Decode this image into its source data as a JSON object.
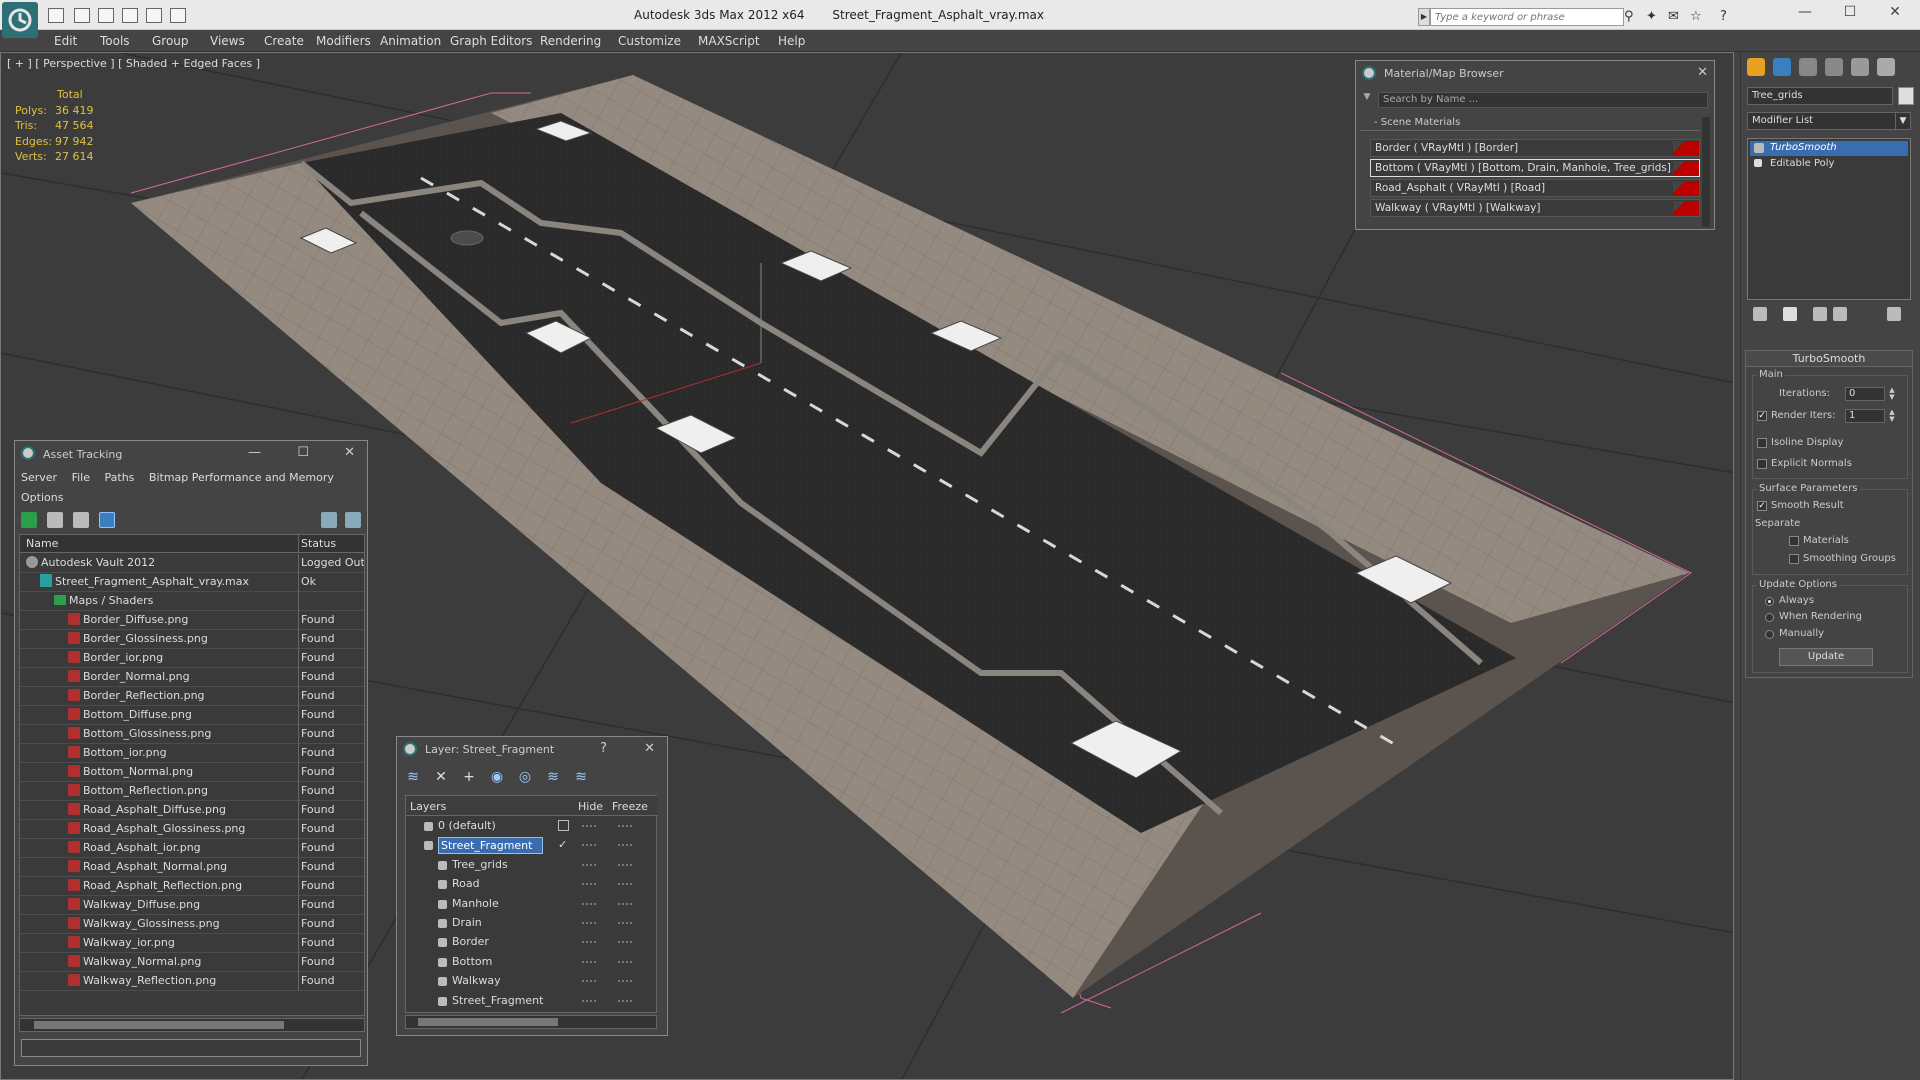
{
  "app": {
    "title_app": "Autodesk 3ds Max  2012 x64",
    "title_file": "Street_Fragment_Asphalt_vray.max",
    "search_placeholder": "Type a keyword or phrase"
  },
  "menu": [
    "Edit",
    "Tools",
    "Group",
    "Views",
    "Create",
    "Modifiers",
    "Animation",
    "Graph Editors",
    "Rendering",
    "Customize",
    "MAXScript",
    "Help"
  ],
  "viewport": {
    "label": "[ + ] [ Perspective ] [ Shaded + Edged Faces ]",
    "stats_header": "Total",
    "stats": [
      {
        "k": "Polys:",
        "v": "36 419"
      },
      {
        "k": "Tris:",
        "v": "47 564"
      },
      {
        "k": "Edges:",
        "v": "97 942"
      },
      {
        "k": "Verts:",
        "v": "27 614"
      }
    ]
  },
  "material_browser": {
    "title": "Material/Map Browser",
    "search_placeholder": "Search by Name ...",
    "section": "- Scene Materials",
    "items": [
      "Border  ( VRayMtl ) [Border]",
      "Bottom  ( VRayMtl ) [Bottom, Drain, Manhole, Tree_grids]",
      "Road_Asphalt  ( VRayMtl ) [Road]",
      "Walkway  ( VRayMtl ) [Walkway]"
    ],
    "selected_index": 1
  },
  "command_panel": {
    "object_name": "Tree_grids",
    "modifier_list": "Modifier List",
    "stack": [
      "TurboSmooth",
      "Editable Poly"
    ],
    "rollout_title": "TurboSmooth",
    "main_group": "Main",
    "iterations_label": "Iterations:",
    "iterations_value": "0",
    "render_iters_label": "Render Iters:",
    "render_iters_value": "1",
    "isoline_label": "Isoline Display",
    "explicit_normals_label": "Explicit Normals",
    "surface_params_label": "Surface Parameters",
    "smooth_result_label": "Smooth Result",
    "separate_label": "Separate",
    "materials_label": "Materials",
    "smoothing_groups_label": "Smoothing Groups",
    "update_options_label": "Update Options",
    "always_label": "Always",
    "when_rendering_label": "When Rendering",
    "manually_label": "Manually",
    "update_button": "Update"
  },
  "asset_tracking": {
    "title": "Asset Tracking",
    "menu": [
      "Server",
      "File",
      "Paths",
      "Bitmap Performance and Memory"
    ],
    "menu2": "Options",
    "col_name": "Name",
    "col_status": "Status",
    "rows": [
      {
        "name": "Autodesk Vault 2012",
        "status": "Logged Out",
        "type": "vault",
        "indent": 0
      },
      {
        "name": "Street_Fragment_Asphalt_vray.max",
        "status": "Ok",
        "type": "doc",
        "indent": 1
      },
      {
        "name": "Maps / Shaders",
        "status": "",
        "type": "folder",
        "indent": 2
      },
      {
        "name": "Border_Diffuse.png",
        "status": "Found",
        "type": "png",
        "indent": 3
      },
      {
        "name": "Border_Glossiness.png",
        "status": "Found",
        "type": "png",
        "indent": 3
      },
      {
        "name": "Border_ior.png",
        "status": "Found",
        "type": "png",
        "indent": 3
      },
      {
        "name": "Border_Normal.png",
        "status": "Found",
        "type": "png",
        "indent": 3
      },
      {
        "name": "Border_Reflection.png",
        "status": "Found",
        "type": "png",
        "indent": 3
      },
      {
        "name": "Bottom_Diffuse.png",
        "status": "Found",
        "type": "png",
        "indent": 3
      },
      {
        "name": "Bottom_Glossiness.png",
        "status": "Found",
        "type": "png",
        "indent": 3
      },
      {
        "name": "Bottom_ior.png",
        "status": "Found",
        "type": "png",
        "indent": 3
      },
      {
        "name": "Bottom_Normal.png",
        "status": "Found",
        "type": "png",
        "indent": 3
      },
      {
        "name": "Bottom_Reflection.png",
        "status": "Found",
        "type": "png",
        "indent": 3
      },
      {
        "name": "Road_Asphalt_Diffuse.png",
        "status": "Found",
        "type": "png",
        "indent": 3
      },
      {
        "name": "Road_Asphalt_Glossiness.png",
        "status": "Found",
        "type": "png",
        "indent": 3
      },
      {
        "name": "Road_Asphalt_ior.png",
        "status": "Found",
        "type": "png",
        "indent": 3
      },
      {
        "name": "Road_Asphalt_Normal.png",
        "status": "Found",
        "type": "png",
        "indent": 3
      },
      {
        "name": "Road_Asphalt_Reflection.png",
        "status": "Found",
        "type": "png",
        "indent": 3
      },
      {
        "name": "Walkway_Diffuse.png",
        "status": "Found",
        "type": "png",
        "indent": 3
      },
      {
        "name": "Walkway_Glossiness.png",
        "status": "Found",
        "type": "png",
        "indent": 3
      },
      {
        "name": "Walkway_ior.png",
        "status": "Found",
        "type": "png",
        "indent": 3
      },
      {
        "name": "Walkway_Normal.png",
        "status": "Found",
        "type": "png",
        "indent": 3
      },
      {
        "name": "Walkway_Reflection.png",
        "status": "Found",
        "type": "png",
        "indent": 3
      }
    ]
  },
  "layers": {
    "title": "Layer: Street_Fragment",
    "help": "?",
    "col_layers": "Layers",
    "col_hide": "Hide",
    "col_freeze": "Freeze",
    "rows": [
      {
        "name": "0 (default)",
        "indent": 0,
        "selected": false
      },
      {
        "name": "Street_Fragment",
        "indent": 0,
        "selected": true
      },
      {
        "name": "Tree_grids",
        "indent": 1,
        "selected": false
      },
      {
        "name": "Road",
        "indent": 1,
        "selected": false
      },
      {
        "name": "Manhole",
        "indent": 1,
        "selected": false
      },
      {
        "name": "Drain",
        "indent": 1,
        "selected": false
      },
      {
        "name": "Border",
        "indent": 1,
        "selected": false
      },
      {
        "name": "Bottom",
        "indent": 1,
        "selected": false
      },
      {
        "name": "Walkway",
        "indent": 1,
        "selected": false
      },
      {
        "name": "Street_Fragment",
        "indent": 1,
        "selected": false
      }
    ]
  }
}
